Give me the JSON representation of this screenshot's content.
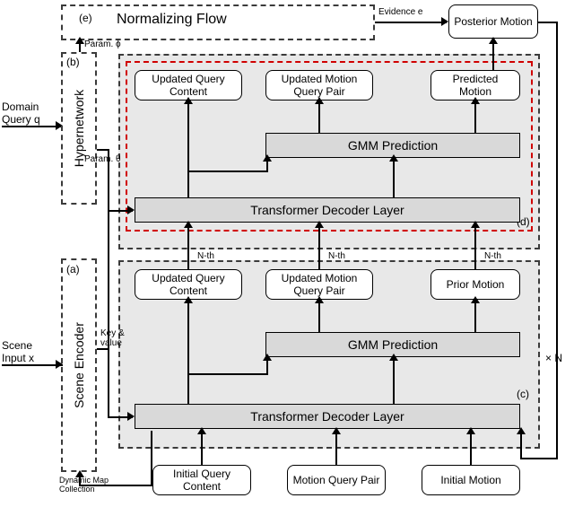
{
  "inputs": {
    "domain_query": "Domain\nQuery q",
    "scene_input": "Scene\nInput x"
  },
  "modules": {
    "normalizing_flow": "Normalizing Flow",
    "hypernetwork": "Hypernetwork",
    "scene_encoder": "Scene Encoder"
  },
  "gray_blocks": {
    "gmm_top": "GMM Prediction",
    "transformer_top": "Transformer Decoder Layer",
    "gmm_bot": "GMM Prediction",
    "transformer_bot": "Transformer Decoder Layer"
  },
  "boxes": {
    "posterior_motion": "Posterior Motion",
    "updated_query_content_top": "Updated Query Content",
    "updated_motion_query_pair_top": "Updated Motion Query Pair",
    "predicted_motion": "Predicted Motion",
    "updated_query_content_bot": "Updated Query Content",
    "updated_motion_query_pair_bot": "Updated Motion Query Pair",
    "prior_motion": "Prior Motion",
    "initial_query_content": "Initial Query Content",
    "motion_query_pair": "Motion Query Pair",
    "initial_motion": "Initial Motion"
  },
  "annotations": {
    "param_phi": "Param. ϕ",
    "param_theta": "Param. θ",
    "key_value": "Key &\nvalue",
    "dynamic_map": "Dynamic Map\nCollection",
    "nth1": "N-th",
    "nth2": "N-th",
    "nth3": "N-th",
    "evidence": "Evidence e",
    "times_n": "× N"
  },
  "tags": {
    "a": "(a)",
    "b": "(b)",
    "c": "(c)",
    "d": "(d)",
    "e": "(e)"
  }
}
